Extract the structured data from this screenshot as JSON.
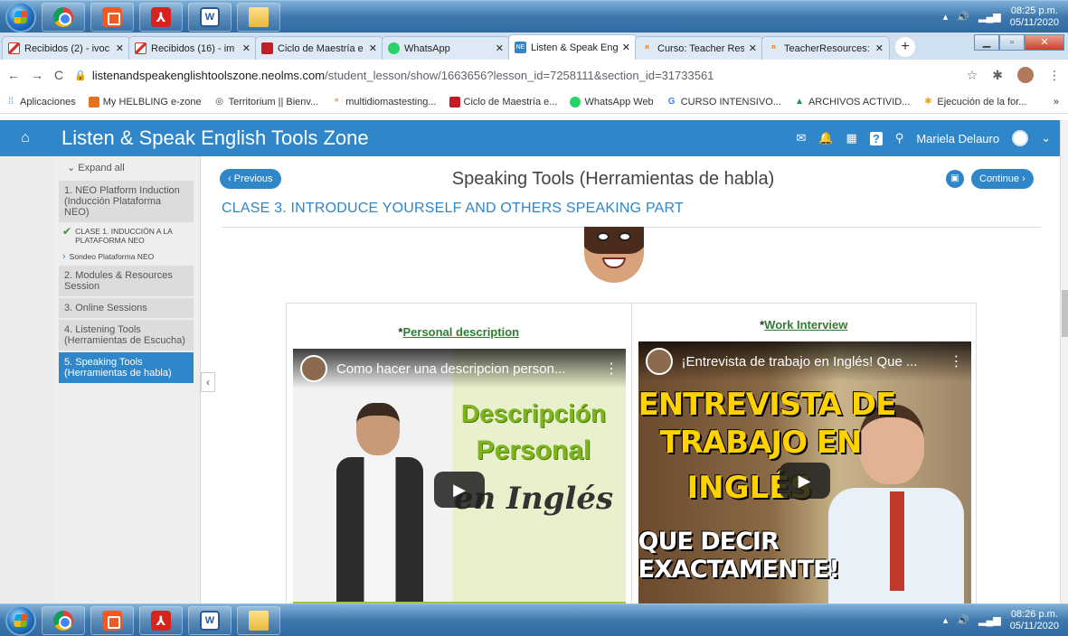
{
  "taskbar": {
    "top_time": "08:25 p.m.",
    "top_date": "05/11/2020",
    "bottom_time": "08:26 p.m.",
    "bottom_date": "05/11/2020",
    "apps": [
      "chrome-icon",
      "outlook-icon",
      "acrobat-icon",
      "word-icon",
      "folder-icon"
    ]
  },
  "tabs": [
    {
      "title": "Recibidos (2) - ivoc",
      "icon": "gmail-icon"
    },
    {
      "title": "Recibidos (16) - im",
      "icon": "gmail-icon"
    },
    {
      "title": "Ciclo de Maestría e",
      "icon": "doc-icon"
    },
    {
      "title": "WhatsApp",
      "icon": "whatsapp-icon"
    },
    {
      "title": "Listen & Speak Eng",
      "icon": "neo-icon",
      "active": true
    },
    {
      "title": "Curso: Teacher Res",
      "icon": "teacherresources-icon"
    },
    {
      "title": "TeacherResources:",
      "icon": "teacherresources-icon"
    }
  ],
  "address": {
    "url_host": "listenandspeakenglishtoolszone.neolms.com",
    "url_path": "/student_lesson/show/1663656?lesson_id=7258111&section_id=31733561"
  },
  "bookmarks": [
    {
      "label": "Aplicaciones",
      "color": "#4285f4"
    },
    {
      "label": "My HELBLING e-zone",
      "color": "#e8711e"
    },
    {
      "label": "Territorium || Bienv...",
      "color": "#444444"
    },
    {
      "label": "multidiomastesting...",
      "color": "#e8711e"
    },
    {
      "label": "Ciclo de Maestría e...",
      "color": "#c41c24"
    },
    {
      "label": "WhatsApp Web",
      "color": "#25d366"
    },
    {
      "label": "CURSO INTENSIVO...",
      "color": "#4285f4"
    },
    {
      "label": "ARCHIVOS ACTIVID...",
      "color": "#0f9d58"
    },
    {
      "label": "Ejecución de la for...",
      "color": "#e8a21e"
    }
  ],
  "bookmarks_more": "»",
  "app": {
    "title": "Listen & Speak English Tools Zone",
    "user_name": "Mariela Delauro"
  },
  "sidebar": {
    "expand_label": "Expand all",
    "items": [
      {
        "label": "1. NEO Platform Induction (Inducción Plataforma NEO)"
      },
      {
        "label": "CLASE 1. INDUCCIÓN A LA PLATAFORMA NEO",
        "sub": true,
        "status": "check"
      },
      {
        "label": "Sondeo Plataforma NEO",
        "sub": true,
        "status": "chevron"
      },
      {
        "label": "2. Modules & Resources Session"
      },
      {
        "label": "3. Online Sessions"
      },
      {
        "label": "4. Listening Tools (Herramientas de Escucha)"
      },
      {
        "label": "5. Speaking Tools (Herramientas de habla)",
        "active": true
      }
    ]
  },
  "content": {
    "prev_label": "Previous",
    "continue_label": "Continue",
    "heading": "Speaking Tools (Herramientas de habla)",
    "section_title": "CLASE 3. INTRODUCE YOURSELF AND OTHERS SPEAKING PART",
    "videos": [
      {
        "prefix": "*",
        "link": "Personal description",
        "title": "Como hacer una descripcion person...",
        "thumb_lines": [
          "Descripción",
          "Personal",
          "en Inglés"
        ]
      },
      {
        "prefix": "*",
        "link": "Work Interview",
        "title": "¡Entrevista de trabajo en Inglés! Que ...",
        "thumb_lines": [
          "ENTREVISTA DE",
          "TRABAJO EN",
          "INGLÉS",
          "QUE DECIR EXACTAMENTE!"
        ]
      }
    ]
  },
  "colors": {
    "brand_blue": "#2f86c9",
    "link_green": "#2e7d32"
  }
}
